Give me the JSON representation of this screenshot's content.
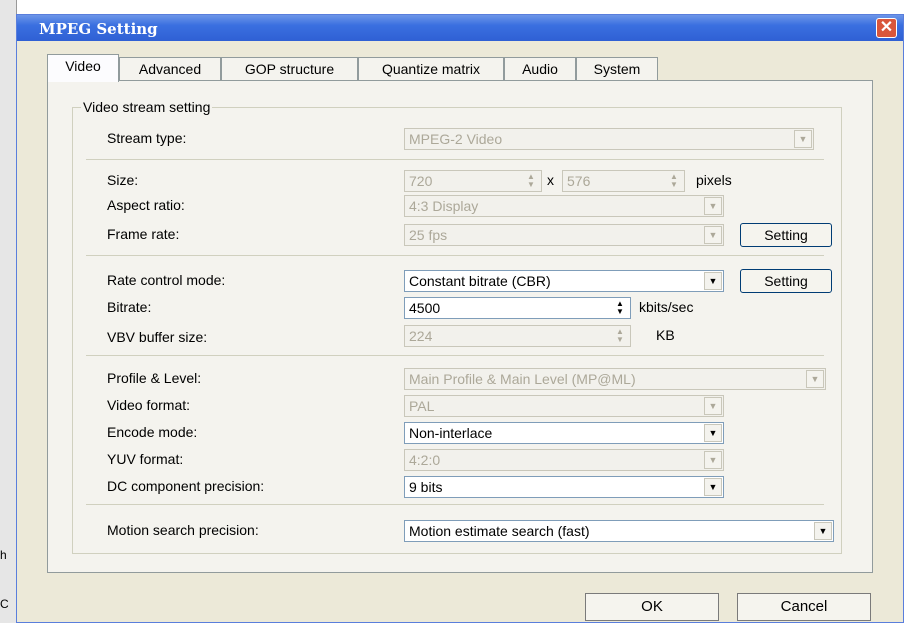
{
  "background_fragments": [
    "h",
    "C"
  ],
  "window": {
    "title": "MPEG Setting",
    "close_glyph": "✕"
  },
  "tabs": [
    "Video",
    "Advanced",
    "GOP structure",
    "Quantize matrix",
    "Audio",
    "System"
  ],
  "group": {
    "title": "Video stream setting",
    "stream_type": {
      "label": "Stream type:",
      "value": "MPEG-2 Video"
    },
    "size": {
      "label": "Size:",
      "width": "720",
      "x": "x",
      "height": "576",
      "unit": "pixels"
    },
    "aspect_ratio": {
      "label": "Aspect ratio:",
      "value": "4:3 Display"
    },
    "frame_rate": {
      "label": "Frame rate:",
      "value": "25 fps",
      "button": "Setting"
    },
    "rate_control": {
      "label": "Rate control mode:",
      "value": "Constant bitrate (CBR)",
      "button": "Setting"
    },
    "bitrate": {
      "label": "Bitrate:",
      "value": "4500",
      "unit": "kbits/sec"
    },
    "vbv": {
      "label": "VBV buffer size:",
      "value": "224",
      "unit": "KB"
    },
    "profile": {
      "label": "Profile & Level:",
      "value": "Main Profile & Main Level (MP@ML)"
    },
    "video_format": {
      "label": "Video format:",
      "value": "PAL"
    },
    "encode_mode": {
      "label": "Encode mode:",
      "value": "Non-interlace"
    },
    "yuv": {
      "label": "YUV format:",
      "value": "4:2:0"
    },
    "dc": {
      "label": "DC component precision:",
      "value": "9 bits"
    },
    "motion": {
      "label": "Motion search precision:",
      "value": "Motion estimate search (fast)"
    }
  },
  "footer": {
    "ok": "OK",
    "cancel": "Cancel"
  },
  "icons": {
    "dropdown": "▼",
    "spin_up": "▲",
    "spin_down": "▼"
  }
}
